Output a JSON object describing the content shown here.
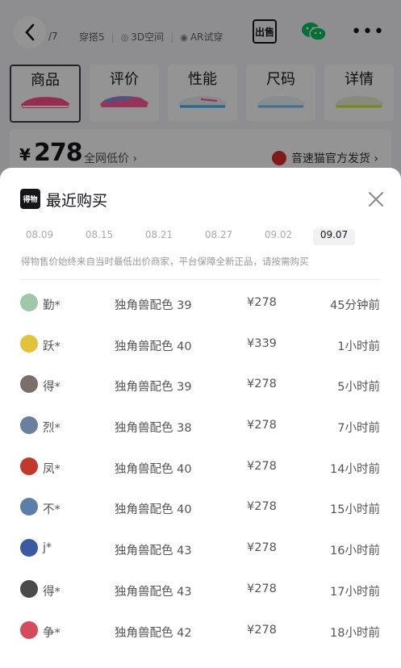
{
  "header": {
    "counter": "/7",
    "nav": [
      {
        "label": "穿搭5",
        "icon": ""
      },
      {
        "label": "3D空间",
        "icon": "3d-icon"
      },
      {
        "label": "AR试穿",
        "icon": "ar-icon"
      }
    ],
    "sell_icon": "出售"
  },
  "tabs": [
    {
      "label": "商品",
      "active": true,
      "accent": "#ff4f8b"
    },
    {
      "label": "评价",
      "active": false,
      "accent": "#ff5c9d"
    },
    {
      "label": "性能",
      "active": false,
      "accent": "#3ab0ff"
    },
    {
      "label": "尺码",
      "active": false,
      "accent": "#6ec3ff"
    },
    {
      "label": "详情",
      "active": false,
      "accent": "#c8e82b"
    }
  ],
  "tabs_more": "10",
  "price": {
    "currency": "¥",
    "value": "278",
    "low_price_label": "全网低价 ›",
    "seller": "音速猫官方发货 ›"
  },
  "sheet": {
    "brand_logo_text": "得物",
    "title": "最近购买",
    "dates": [
      "08.09",
      "08.15",
      "08.21",
      "08.27",
      "09.02",
      "09.07"
    ],
    "active_date": "09.07",
    "note": "得物售价始终来自当时最低出价商家，平台保障全新正品，请按需购买",
    "rows": [
      {
        "user": "勤*",
        "sku": "独角兽配色 39",
        "price": "¥278",
        "time": "45分钟前",
        "avatar_color": "#9fc7a8"
      },
      {
        "user": "跃*",
        "sku": "独角兽配色 40",
        "price": "¥339",
        "time": "1小时前",
        "avatar_color": "#e2c23b"
      },
      {
        "user": "得*",
        "sku": "独角兽配色 39",
        "price": "¥278",
        "time": "5小时前",
        "avatar_color": "#7a6f6a"
      },
      {
        "user": "烈*",
        "sku": "独角兽配色 38",
        "price": "¥278",
        "time": "7小时前",
        "avatar_color": "#6b7f9f"
      },
      {
        "user": "凤*",
        "sku": "独角兽配色 40",
        "price": "¥278",
        "time": "14小时前",
        "avatar_color": "#c0392b"
      },
      {
        "user": "不*",
        "sku": "独角兽配色 40",
        "price": "¥278",
        "time": "15小时前",
        "avatar_color": "#5b7fa8"
      },
      {
        "user": "j*",
        "sku": "独角兽配色 43",
        "price": "¥278",
        "time": "16小时前",
        "avatar_color": "#3b5aa3"
      },
      {
        "user": "得*",
        "sku": "独角兽配色 43",
        "price": "¥278",
        "time": "17小时前",
        "avatar_color": "#4a4a4a"
      },
      {
        "user": "争*",
        "sku": "独角兽配色 42",
        "price": "¥278",
        "time": "18小时前",
        "avatar_color": "#d64b5b"
      }
    ]
  }
}
